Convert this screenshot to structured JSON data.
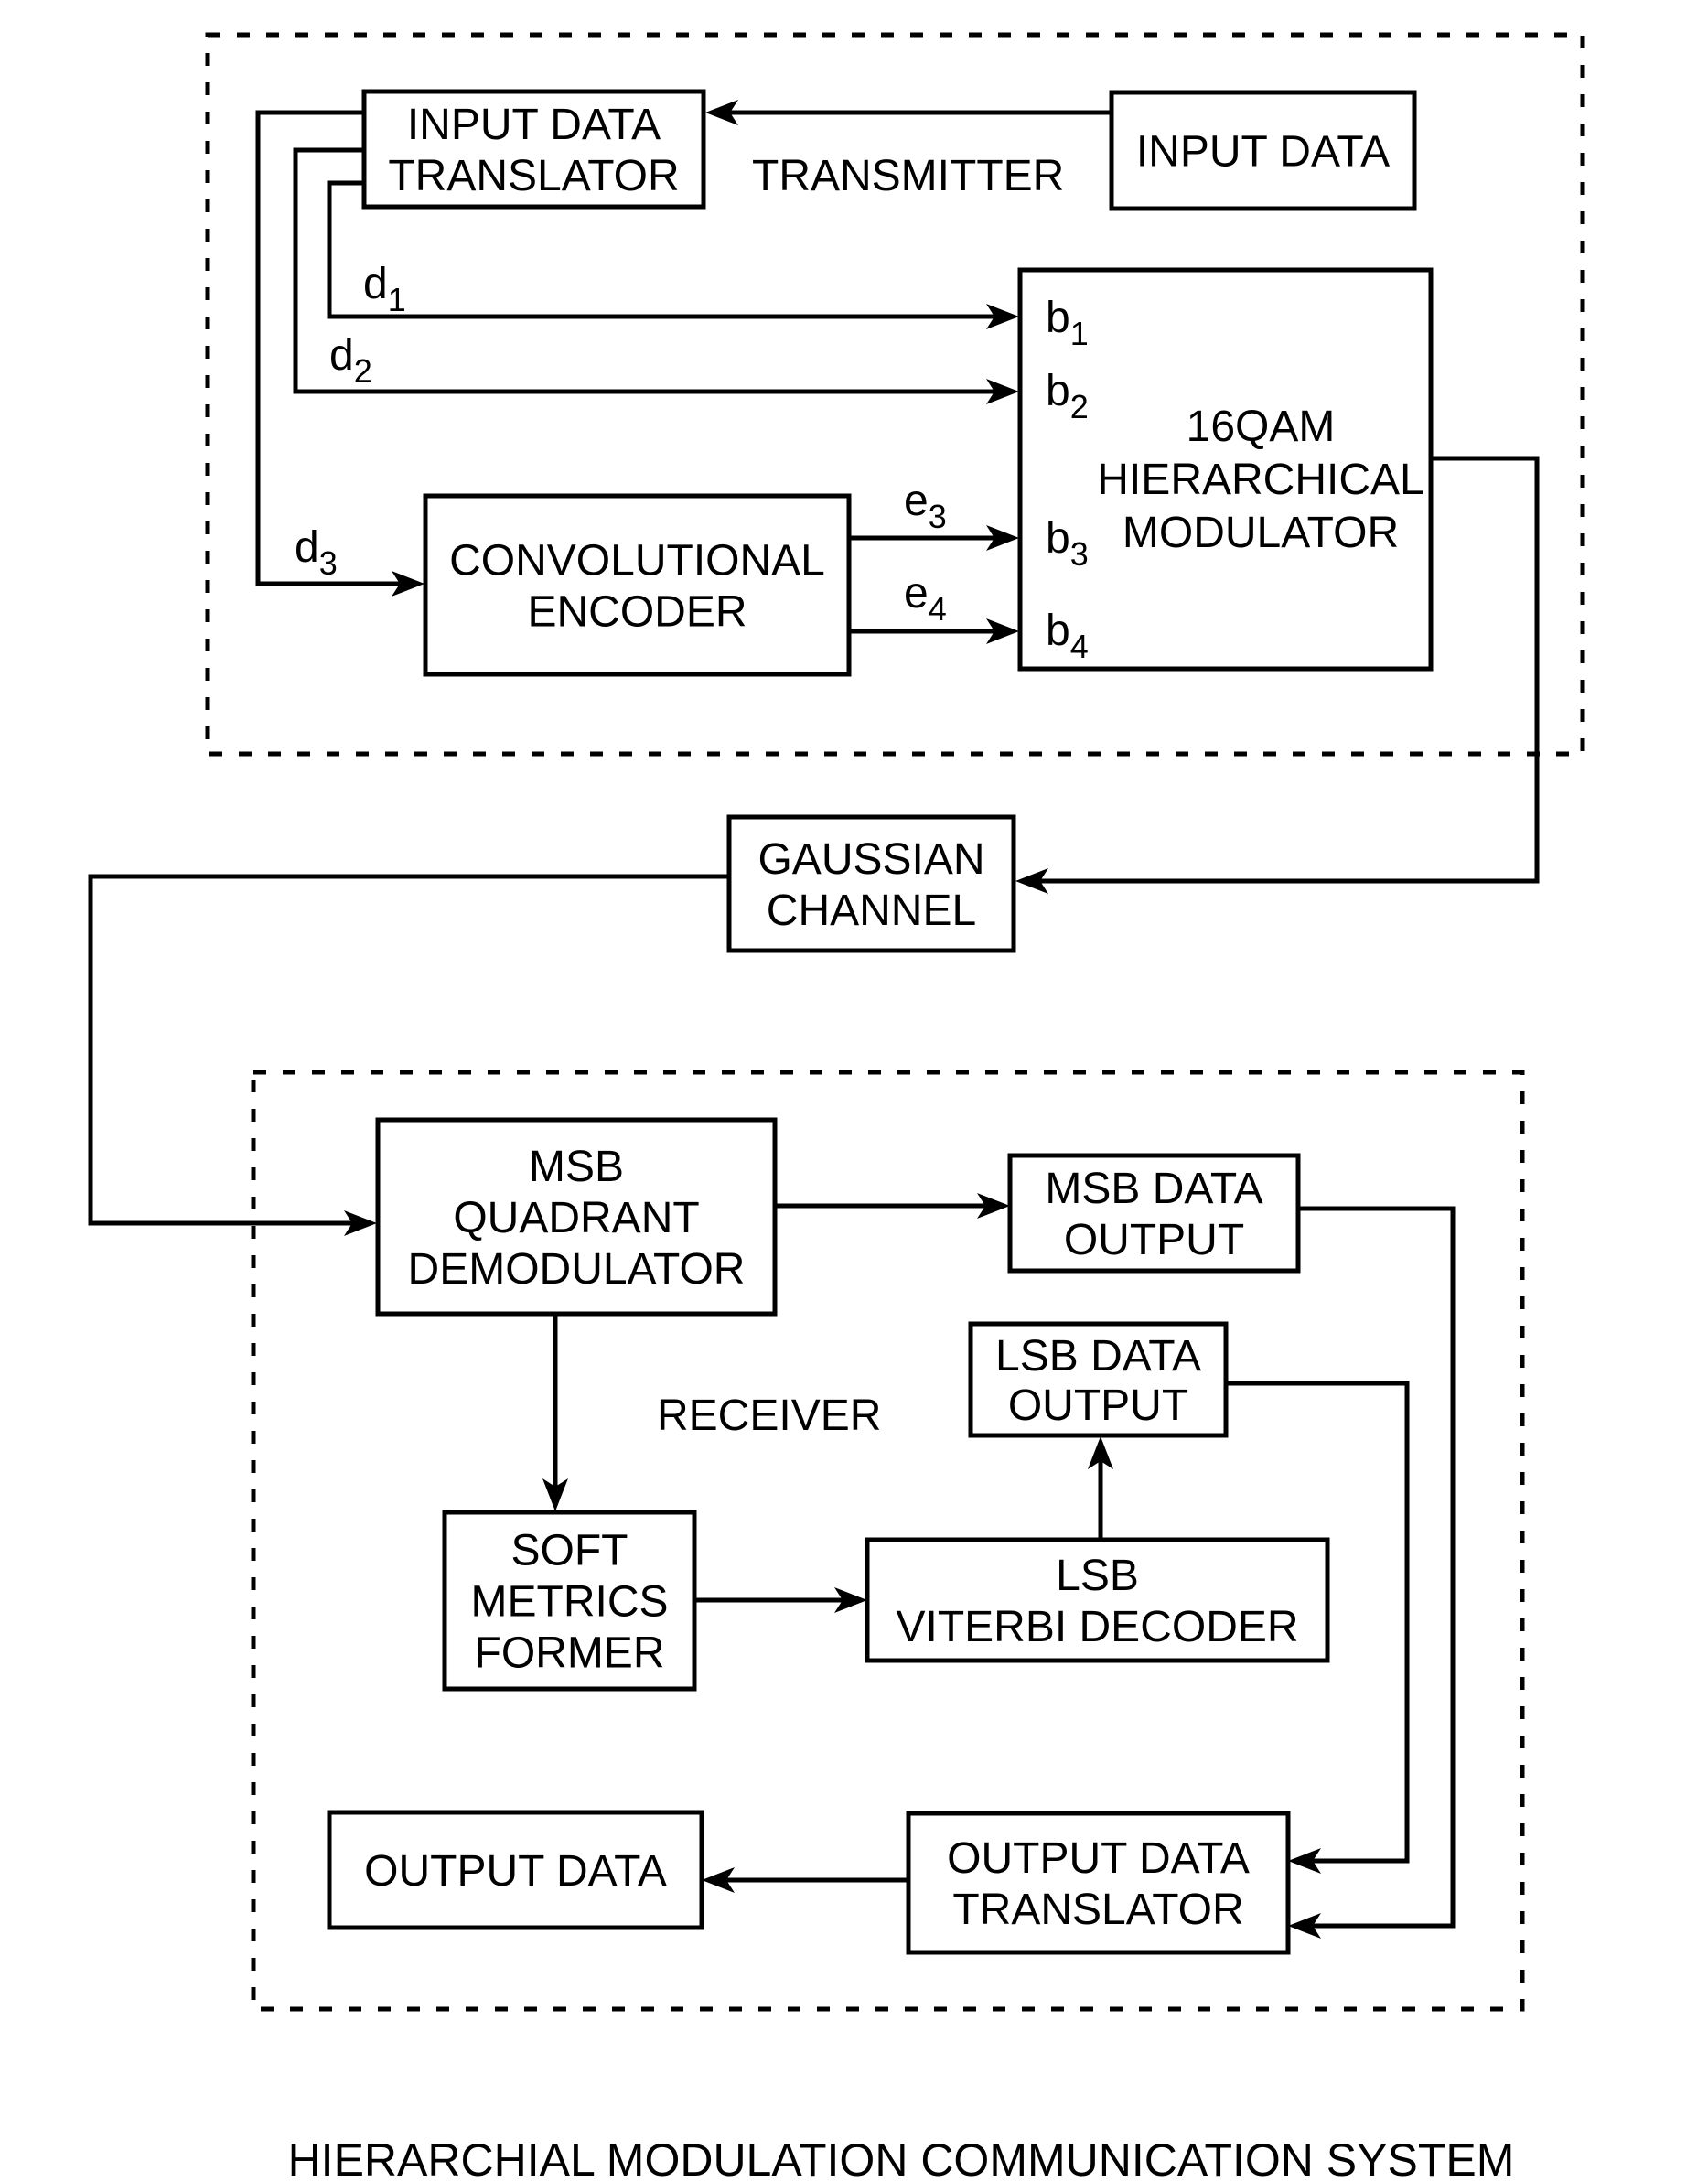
{
  "figure": {
    "title": "HIERARCHIAL MODULATION COMMUNICATION SYSTEM",
    "line_color": "#000000",
    "background": "#ffffff"
  },
  "transmitter": {
    "label": "TRANSMITTER",
    "blocks": {
      "input_data": [
        "INPUT DATA"
      ],
      "input_data_translator": [
        "INPUT DATA",
        "TRANSLATOR"
      ],
      "convolutional_encoder": [
        "CONVOLUTIONAL",
        "ENCODER"
      ],
      "modulator": [
        "16QAM",
        "HIERARCHICAL",
        "MODULATOR"
      ]
    },
    "signals": {
      "d1": {
        "base": "d",
        "sub": "1"
      },
      "d2": {
        "base": "d",
        "sub": "2"
      },
      "d3": {
        "base": "d",
        "sub": "3"
      },
      "e3": {
        "base": "e",
        "sub": "3"
      },
      "e4": {
        "base": "e",
        "sub": "4"
      },
      "b1": {
        "base": "b",
        "sub": "1"
      },
      "b2": {
        "base": "b",
        "sub": "2"
      },
      "b3": {
        "base": "b",
        "sub": "3"
      },
      "b4": {
        "base": "b",
        "sub": "4"
      }
    }
  },
  "channel": {
    "gaussian_channel": [
      "GAUSSIAN",
      "CHANNEL"
    ]
  },
  "receiver": {
    "label": "RECEIVER",
    "blocks": {
      "msb_quadrant_demodulator": [
        "MSB",
        "QUADRANT",
        "DEMODULATOR"
      ],
      "msb_data_output": [
        "MSB DATA",
        "OUTPUT"
      ],
      "lsb_data_output": [
        "LSB DATA",
        "OUTPUT"
      ],
      "soft_metrics_former": [
        "SOFT",
        "METRICS",
        "FORMER"
      ],
      "lsb_viterbi_decoder": [
        "LSB",
        "VITERBI DECODER"
      ],
      "output_data": [
        "OUTPUT DATA"
      ],
      "output_data_translator": [
        "OUTPUT DATA",
        "TRANSLATOR"
      ]
    }
  }
}
